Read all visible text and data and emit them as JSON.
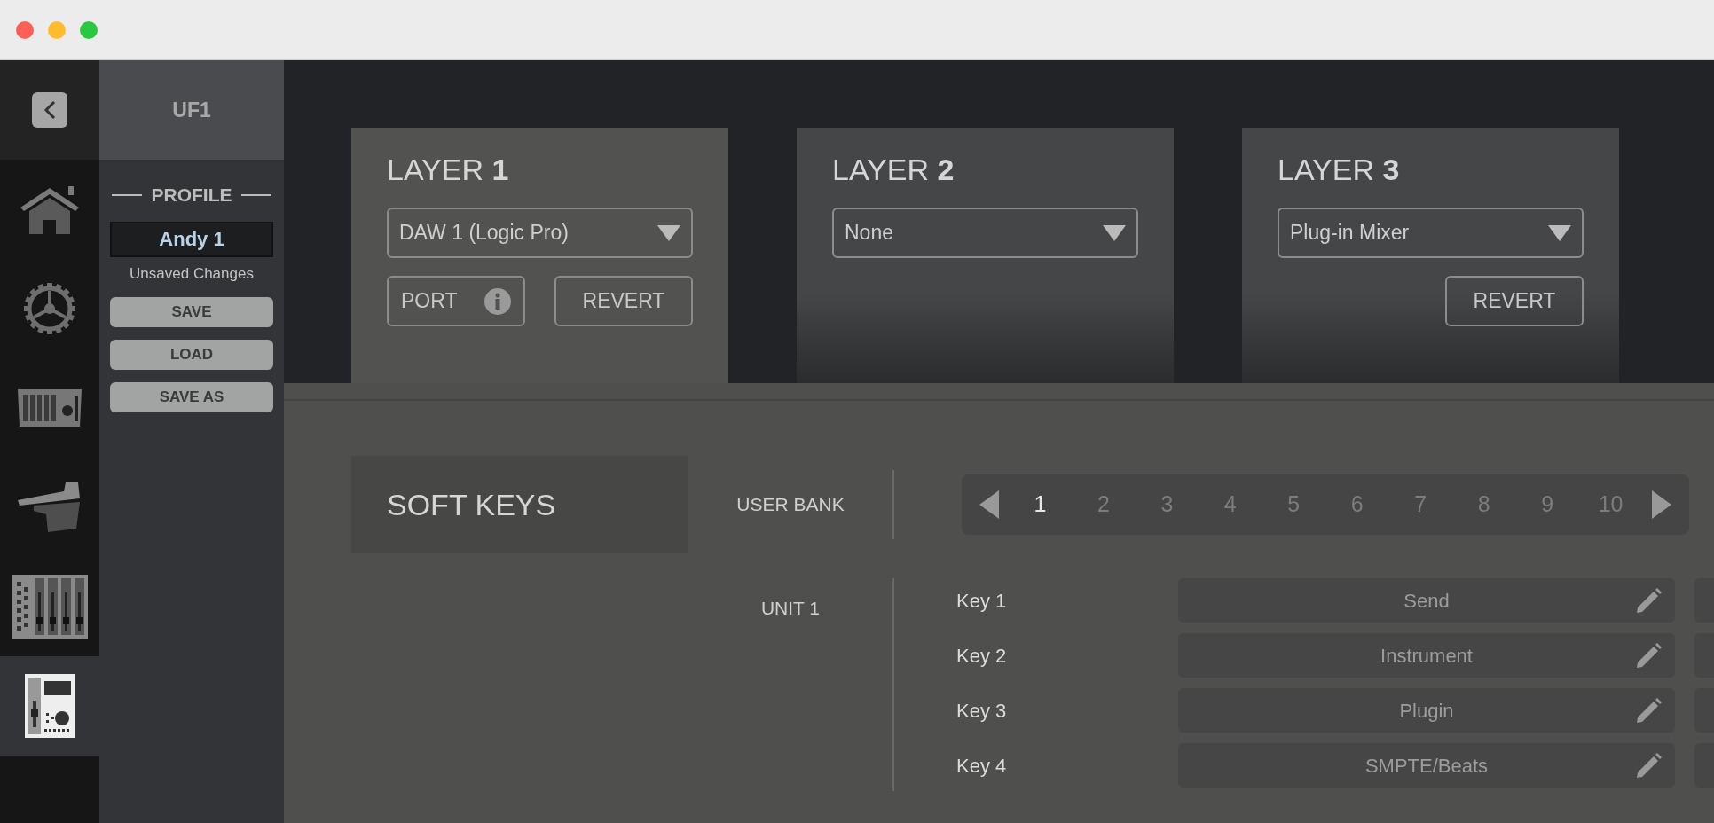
{
  "sidebar": {
    "device": "UF1",
    "nav_items": [
      {
        "kind": "home",
        "selected": false
      },
      {
        "kind": "settings",
        "selected": false
      },
      {
        "kind": "console",
        "selected": false
      },
      {
        "kind": "controller",
        "selected": false
      },
      {
        "kind": "mixer",
        "selected": false
      },
      {
        "kind": "unit",
        "selected": true
      }
    ]
  },
  "profile": {
    "heading": "PROFILE",
    "name": "Andy 1",
    "status": "Unsaved Changes",
    "buttons": [
      "SAVE",
      "LOAD",
      "SAVE AS"
    ]
  },
  "layers": [
    {
      "title": "LAYER **1**",
      "selected": true,
      "dropdown": "DAW 1 (Logic Pro)",
      "port": "PORT",
      "revert": "REVERT"
    },
    {
      "title": "LAYER **2**",
      "selected": false,
      "dropdown": "None"
    },
    {
      "title": "LAYER **3**",
      "selected": false,
      "dropdown": "Plug-in Mixer",
      "revert": "REVERT"
    }
  ],
  "soft_keys": {
    "title": "SOFT KEYS",
    "bank_label": "USER BANK",
    "banks": [
      {
        "label": "1",
        "selected": true
      },
      {
        "label": "2",
        "selected": false
      },
      {
        "label": "3",
        "selected": false
      },
      {
        "label": "4",
        "selected": false
      },
      {
        "label": "5",
        "selected": false
      },
      {
        "label": "6",
        "selected": false
      },
      {
        "label": "7",
        "selected": false
      },
      {
        "label": "8",
        "selected": false
      },
      {
        "label": "9",
        "selected": false
      },
      {
        "label": "10",
        "selected": false
      }
    ],
    "unit": "UNIT 1",
    "keys": [
      {
        "label": "Key 1",
        "value": "Send"
      },
      {
        "label": "Key 2",
        "value": "Instrument"
      },
      {
        "label": "Key 3",
        "value": "Plugin"
      },
      {
        "label": "Key 4",
        "value": "SMPTE/Beats"
      }
    ]
  }
}
